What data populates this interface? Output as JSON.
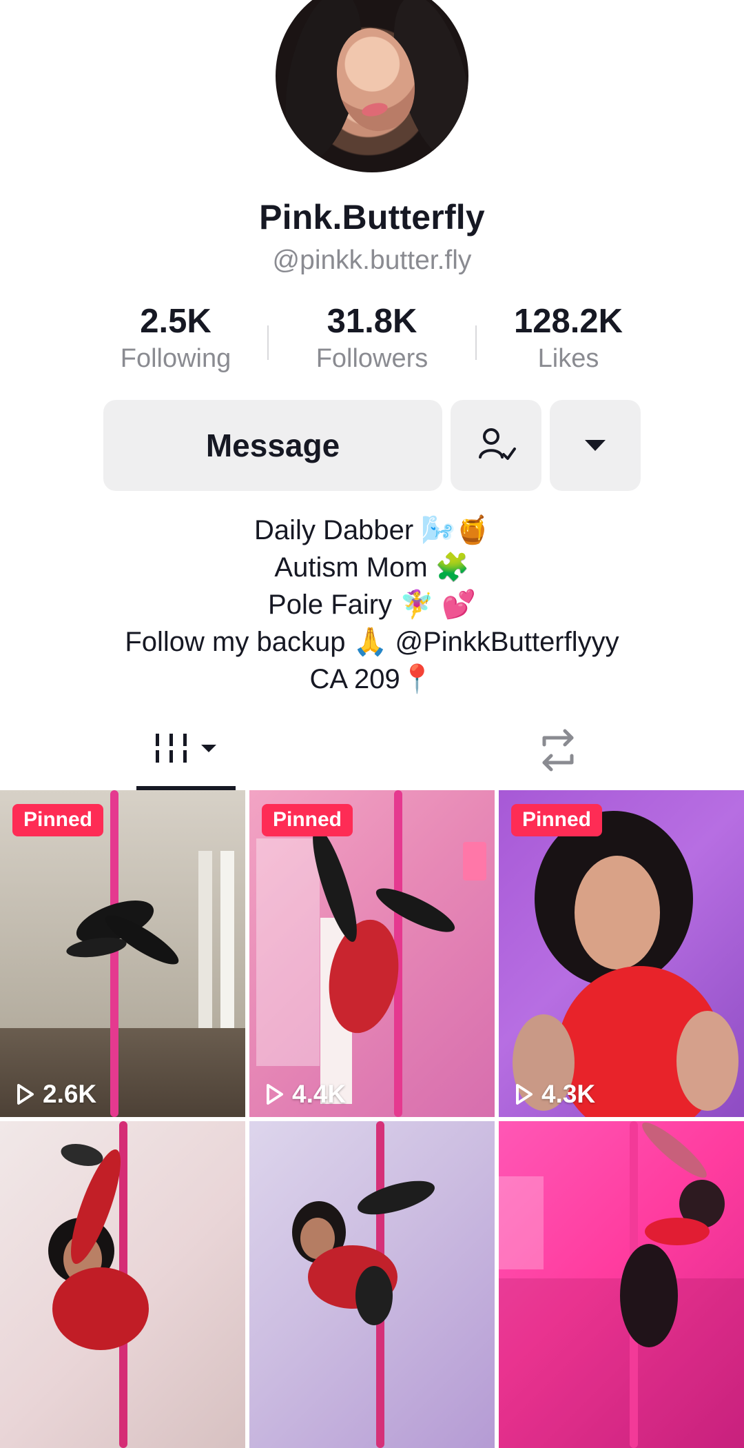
{
  "profile": {
    "display_name": "Pink.Butterfly",
    "username": "@pinkk.butter.fly",
    "avatar_icon": "profile-avatar-photo"
  },
  "stats": {
    "following": {
      "count": "2.5K",
      "label": "Following"
    },
    "followers": {
      "count": "31.8K",
      "label": "Followers"
    },
    "likes": {
      "count": "128.2K",
      "label": "Likes"
    }
  },
  "actions": {
    "message_label": "Message",
    "friend_icon": "person-check-icon",
    "more_icon": "caret-down-icon"
  },
  "bio": [
    "Daily Dabber 🌬️🍯",
    "Autism Mom 🧩",
    "Pole Fairy 🧚‍♀️ 💕",
    "Follow my backup 🙏 @PinkkButterflyyy",
    "CA 209📍"
  ],
  "tabs": {
    "videos_icon": "grid-icon",
    "reposts_icon": "repost-icon"
  },
  "videos": [
    {
      "pinned": "Pinned",
      "views": "2.6K"
    },
    {
      "pinned": "Pinned",
      "views": "4.4K"
    },
    {
      "pinned": "Pinned",
      "views": "4.3K"
    },
    {
      "pinned": "",
      "views": ""
    },
    {
      "pinned": "",
      "views": ""
    },
    {
      "pinned": "",
      "views": ""
    }
  ],
  "colors": {
    "accent": "#fe2c55",
    "text": "#161823",
    "secondary_text": "#8a8b91",
    "button_bg": "#efeff0"
  }
}
